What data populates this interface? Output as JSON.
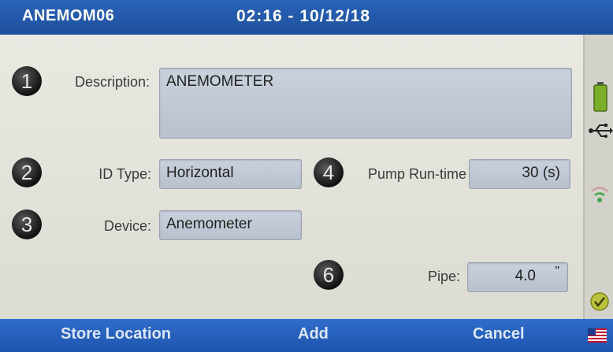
{
  "header": {
    "title": "ANEMOM06",
    "datetime": "02:16 - 10/12/18"
  },
  "form": {
    "description": {
      "number": "1",
      "label": "Description:",
      "value": "ANEMOMETER"
    },
    "id_type": {
      "number": "2",
      "label": "ID Type:",
      "value": "Horizontal"
    },
    "device": {
      "number": "3",
      "label": "Device:",
      "value": "Anemometer"
    },
    "pump_runtime": {
      "number": "4",
      "label": "Pump Run-time",
      "value": "30  (s)"
    },
    "pipe": {
      "number": "6",
      "label": "Pipe:",
      "value": "4.0",
      "unit": "\""
    }
  },
  "footer": {
    "store_location": "Store Location",
    "add": "Add",
    "cancel": "Cancel"
  },
  "sidebar_icons": [
    "battery-icon",
    "usb-icon",
    "wifi-icon",
    "check-icon",
    "us-flag-icon"
  ],
  "colors": {
    "header": "#1d4f9c",
    "footer": "#1e55ad",
    "battery": "#7cae2a"
  }
}
